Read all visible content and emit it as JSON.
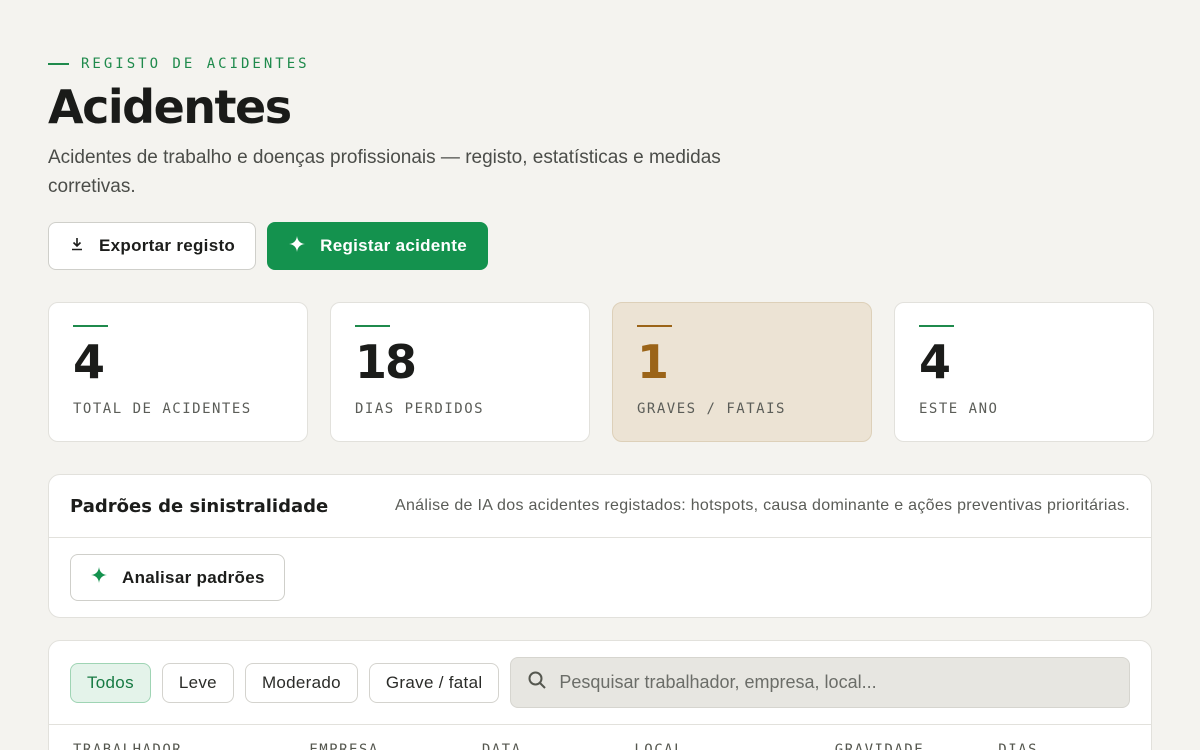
{
  "header": {
    "eyebrow": "REGISTO DE ACIDENTES",
    "title": "Acidentes",
    "subtitle": "Acidentes de trabalho e doenças profissionais — registo, estatísticas e medidas corretivas."
  },
  "actions": {
    "export_label": "Exportar registo",
    "register_label": "Registar acidente"
  },
  "stats": [
    {
      "value": "4",
      "label": "TOTAL DE ACIDENTES"
    },
    {
      "value": "18",
      "label": "DIAS PERDIDOS"
    },
    {
      "value": "1",
      "label": "GRAVES / FATAIS"
    },
    {
      "value": "4",
      "label": "ESTE ANO"
    }
  ],
  "patterns": {
    "title": "Padrões de sinistralidade",
    "description": "Análise de IA dos acidentes registados: hotspots, causa dominante e ações preventivas prioritárias.",
    "analyze_label": "Analisar padrões"
  },
  "filters": {
    "chips": [
      "Todos",
      "Leve",
      "Moderado",
      "Grave / fatal"
    ],
    "active": "Todos",
    "search_placeholder": "Pesquisar trabalhador, empresa, local..."
  },
  "table": {
    "columns": [
      "TRABALHADOR",
      "EMPRESA",
      "DATA",
      "LOCAL",
      "GRAVIDADE",
      "DIAS PERDIDOS"
    ]
  },
  "colors": {
    "accent": "#14924e",
    "warning": "#9b6418",
    "background": "#f4f3ef"
  }
}
